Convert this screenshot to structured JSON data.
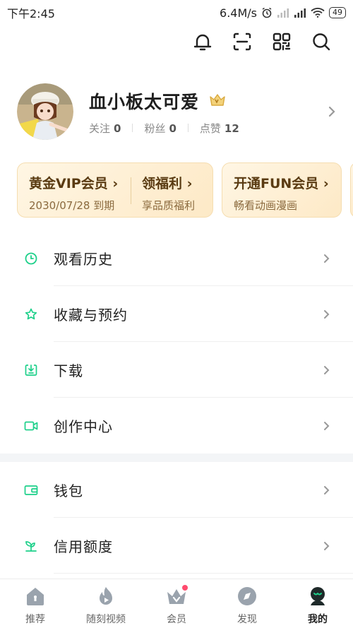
{
  "status_bar": {
    "time": "下午2:45",
    "speed": "6.4M/s",
    "battery": "49"
  },
  "profile": {
    "name": "血小板太可爱",
    "vip_badge": "vip-crown-badge",
    "stats": [
      {
        "label": "关注",
        "value": "0"
      },
      {
        "label": "粉丝",
        "value": "0"
      },
      {
        "label": "点赞",
        "value": "12"
      }
    ]
  },
  "vip_cards": {
    "gold": {
      "title": "黄金VIP会员 ›",
      "subtitle": "2030/07/28 到期"
    },
    "welfare": {
      "title": "领福利 ›",
      "subtitle": "享品质福利"
    },
    "fun": {
      "title": "开通FUN会员 ›",
      "subtitle": "畅看动画漫画"
    }
  },
  "menu": [
    {
      "label": "观看历史",
      "icon": "clock-icon"
    },
    {
      "label": "收藏与预约",
      "icon": "star-icon"
    },
    {
      "label": "下载",
      "icon": "download-icon"
    },
    {
      "label": "创作中心",
      "icon": "video-camera-icon"
    },
    {
      "label": "钱包",
      "icon": "wallet-icon"
    },
    {
      "label": "信用额度",
      "icon": "sprout-icon"
    }
  ],
  "bottom_nav": [
    {
      "label": "推荐",
      "icon": "home-icon"
    },
    {
      "label": "随刻视频",
      "icon": "flame-icon"
    },
    {
      "label": "会员",
      "icon": "crown-icon"
    },
    {
      "label": "发现",
      "icon": "compass-icon"
    },
    {
      "label": "我的",
      "icon": "profile-icon"
    }
  ],
  "colors": {
    "accent_green": "#1dd08a",
    "gold_text": "#5a3b12"
  }
}
